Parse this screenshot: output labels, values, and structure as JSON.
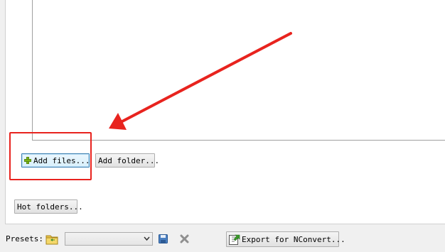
{
  "buttons": {
    "add_files": "Add files...",
    "add_folder": "Add folder...",
    "hot_folders": "Hot folders...",
    "export": "Export for NConvert..."
  },
  "presets": {
    "label": "Presets:",
    "selected": ""
  },
  "icons": {
    "add_files": "plus-icon",
    "open_preset": "folder-icon",
    "save_preset": "save-icon",
    "delete_preset": "delete-icon",
    "export": "export-icon"
  },
  "colors": {
    "annotation_red": "#e8231e",
    "focus_blue": "#3c7fb1",
    "plus_green": "#7cb518"
  }
}
